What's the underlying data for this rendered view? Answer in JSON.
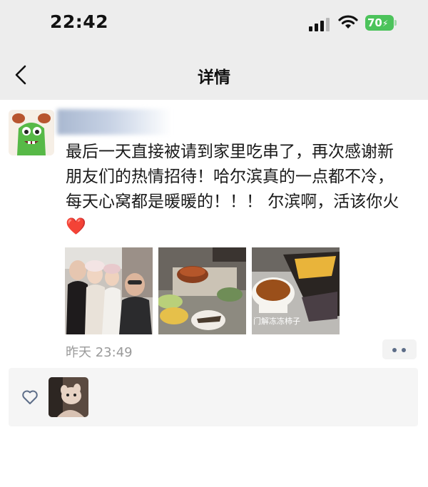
{
  "status_bar": {
    "time": "22:42",
    "battery_level": "70",
    "battery_color": "#4cc35b"
  },
  "nav": {
    "title": "详情",
    "back_icon": "chevron-left-icon"
  },
  "post": {
    "text": "最后一天直接被请到家里吃串了，再次感谢新朋友们的热情招待！哈尔滨真的一点都不冷，每天心窝都是暖暖的！！！ 尔滨啊，活该你火",
    "emoji": "❤️",
    "timestamp": "昨天 23:49",
    "photos": [
      {
        "name": "group-selfie-photo"
      },
      {
        "name": "hotpot-table-photo"
      },
      {
        "name": "frozen-persimmon-photo",
        "caption": "门解冻冻柿子"
      }
    ]
  },
  "likes": {
    "icon": "heart-outline-icon"
  },
  "colors": {
    "accent": "#5d6d88",
    "background": "#ededed",
    "timestamp": "#9a9a9a"
  }
}
